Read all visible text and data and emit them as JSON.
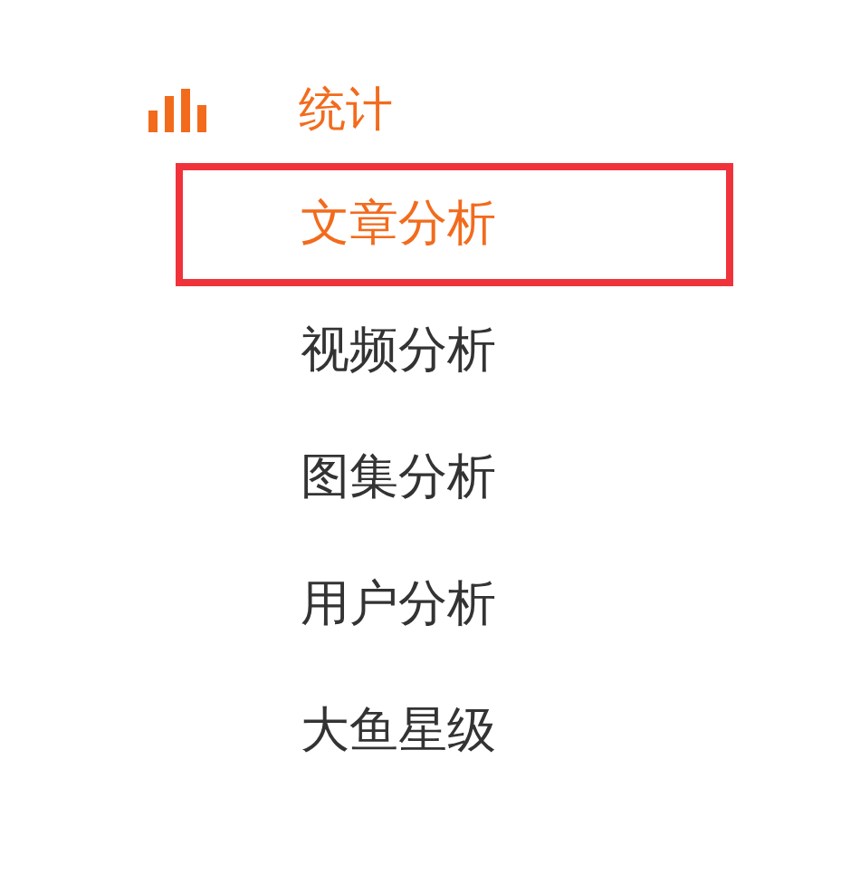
{
  "section": {
    "title": "统计"
  },
  "items": [
    {
      "label": "文章分析",
      "selected": true
    },
    {
      "label": "视频分析",
      "selected": false
    },
    {
      "label": "图集分析",
      "selected": false
    },
    {
      "label": "用户分析",
      "selected": false
    },
    {
      "label": "大鱼星级",
      "selected": false
    }
  ]
}
